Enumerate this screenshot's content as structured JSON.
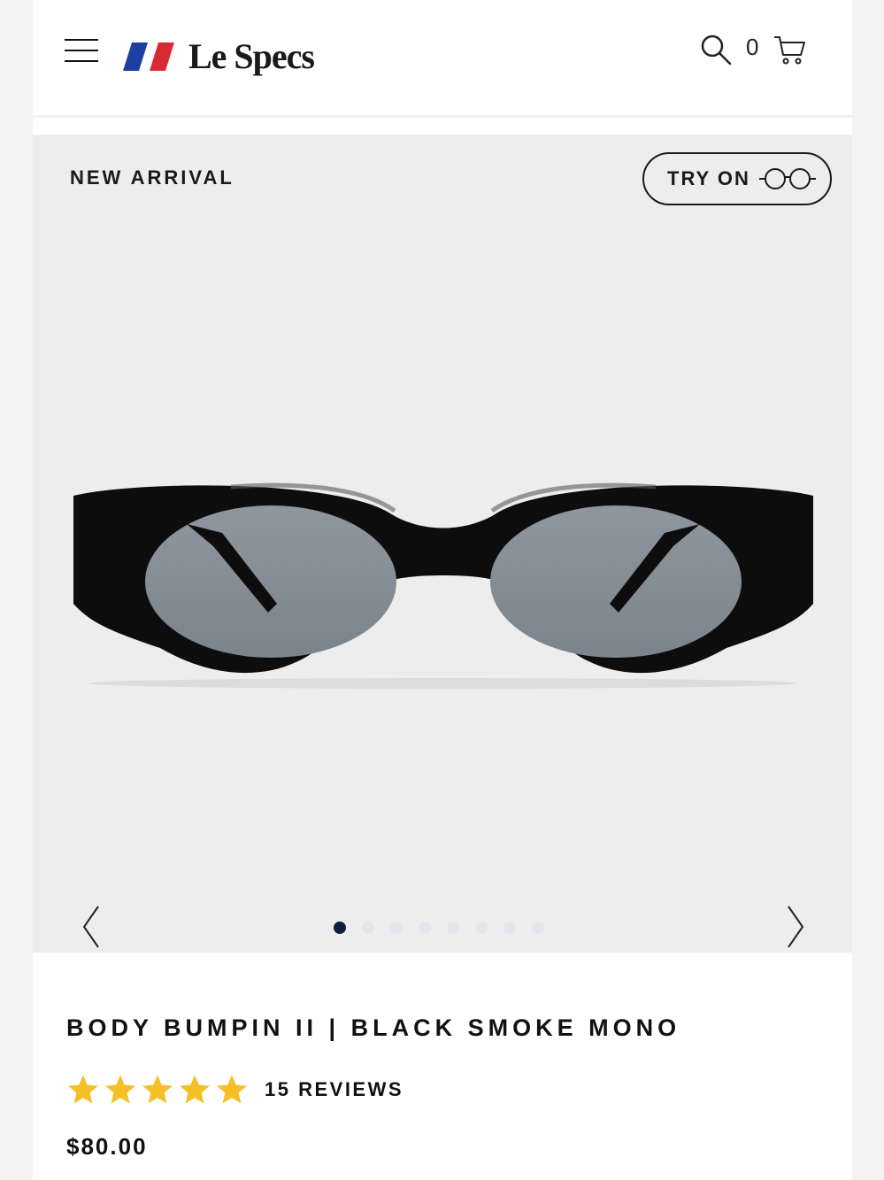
{
  "header": {
    "brand": "Le Specs",
    "cart_count": "0",
    "flag_colors": [
      "#1d3fa0",
      "#d62b32"
    ]
  },
  "gallery": {
    "badge": "NEW ARRIVAL",
    "try_on_label": "TRY ON",
    "slide_count": 8,
    "active_slide": 1
  },
  "product": {
    "title": "BODY BUMPIN II | BLACK SMOKE MONO",
    "rating": 5,
    "reviews_label": "15 REVIEWS",
    "price": "$80.00"
  },
  "colors": {
    "star": "#f4c025",
    "active_dot": "#0f1d3b",
    "gallery_bg": "#ededed"
  },
  "icons": [
    "menu-icon",
    "search-icon",
    "cart-icon",
    "glasses-icon",
    "chevron-left-icon",
    "chevron-right-icon",
    "star-icon"
  ]
}
